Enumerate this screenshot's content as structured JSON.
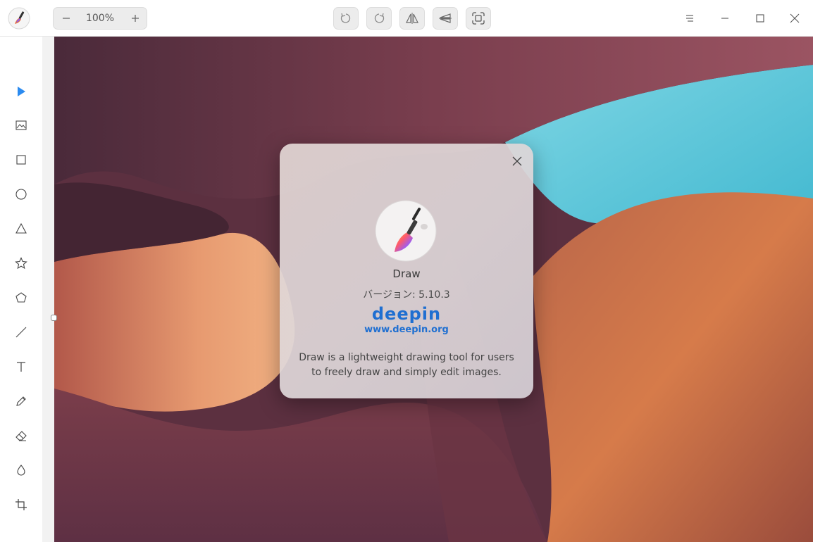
{
  "toolbar": {
    "zoom_value": "100%",
    "zoom_out_icon": "minus-icon",
    "zoom_in_icon": "plus-icon",
    "undo_icon": "undo-icon",
    "redo_icon": "redo-icon",
    "flip_horizontal_icon": "flip-horizontal-icon",
    "flip_vertical_icon": "flip-vertical-icon",
    "fit_screen_icon": "fit-screen-icon"
  },
  "window_controls": [
    "menu-icon",
    "minimize-icon",
    "maximize-icon",
    "close-icon"
  ],
  "sidebar": {
    "items": [
      {
        "name": "select-tool",
        "icon": "pointer-icon",
        "active": true
      },
      {
        "name": "image-tool",
        "icon": "image-icon"
      },
      {
        "name": "rectangle-tool",
        "icon": "rectangle-icon"
      },
      {
        "name": "ellipse-tool",
        "icon": "ellipse-icon"
      },
      {
        "name": "triangle-tool",
        "icon": "triangle-icon"
      },
      {
        "name": "star-tool",
        "icon": "star-icon"
      },
      {
        "name": "polygon-tool",
        "icon": "polygon-icon"
      },
      {
        "name": "line-tool",
        "icon": "line-icon"
      },
      {
        "name": "text-tool",
        "icon": "text-icon"
      },
      {
        "name": "pencil-tool",
        "icon": "pencil-icon"
      },
      {
        "name": "eraser-tool",
        "icon": "eraser-icon"
      },
      {
        "name": "blur-tool",
        "icon": "drop-icon"
      },
      {
        "name": "crop-tool",
        "icon": "crop-icon"
      }
    ]
  },
  "about_dialog": {
    "app_name": "Draw",
    "version": "バージョン: 5.10.3",
    "brand": "deepin",
    "website": "www.deepin.org",
    "description": "Draw is a lightweight drawing tool for users to freely draw and simply edit images."
  },
  "colors": {
    "accent": "#2b8bf0",
    "link": "#1f6fd1"
  }
}
